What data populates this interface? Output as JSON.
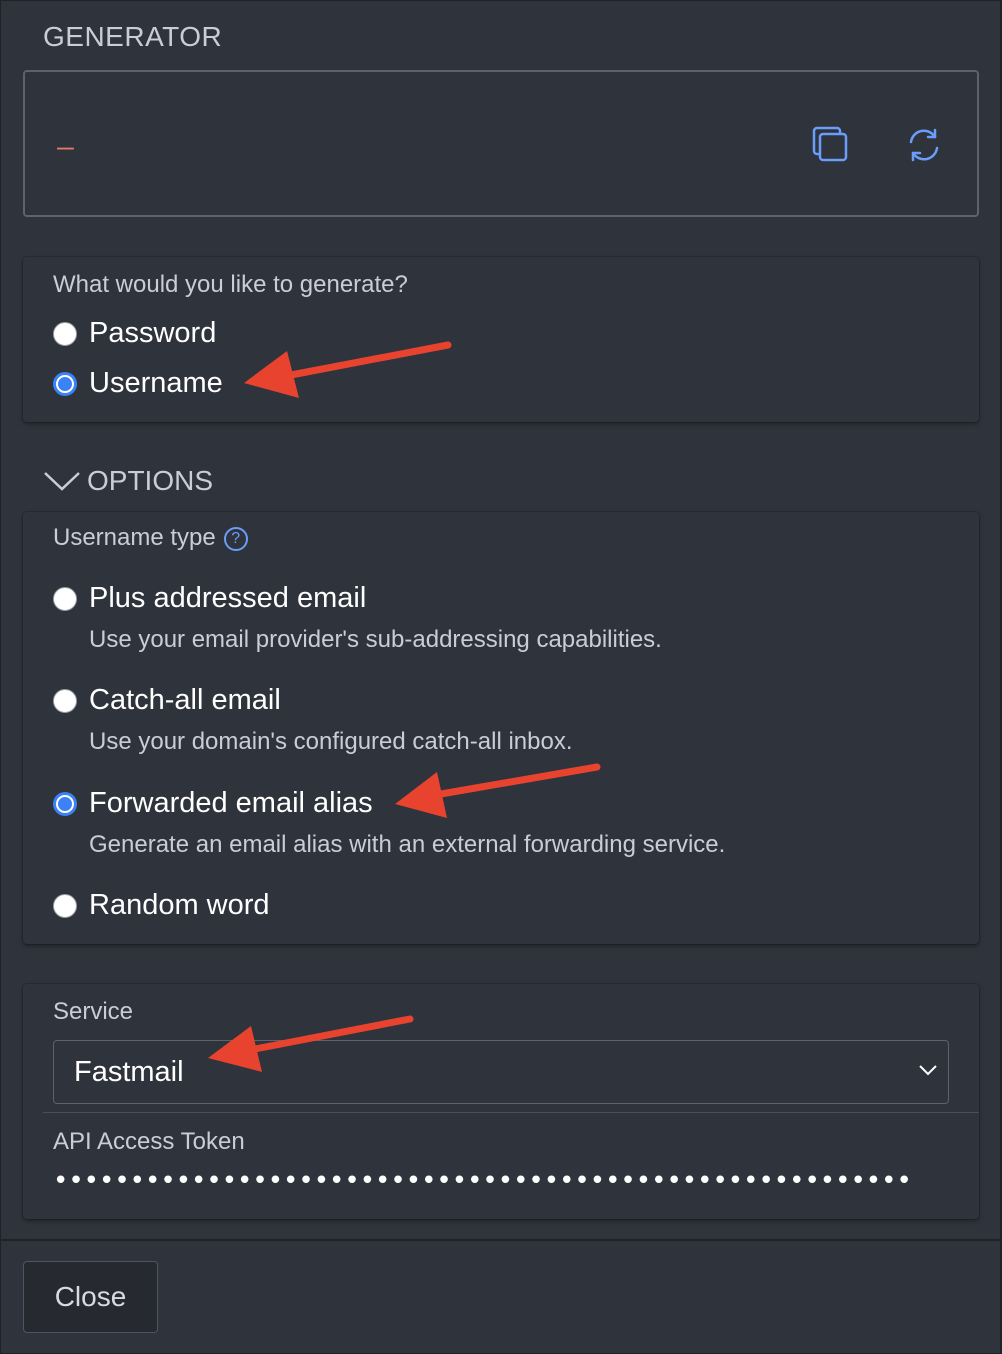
{
  "header": {
    "title": "GENERATOR"
  },
  "generator": {
    "value": "–",
    "copy_icon": "copy-icon",
    "regenerate_icon": "refresh-icon"
  },
  "type_section": {
    "question": "What would you like to generate?",
    "options": [
      {
        "label": "Password",
        "checked": false
      },
      {
        "label": "Username",
        "checked": true
      }
    ]
  },
  "options_section": {
    "header": "OPTIONS",
    "username_type_label": "Username type",
    "help_icon": "?",
    "types": [
      {
        "label": "Plus addressed email",
        "hint": "Use your email provider's sub-addressing capabilities.",
        "checked": false
      },
      {
        "label": "Catch-all email",
        "hint": "Use your domain's configured catch-all inbox.",
        "checked": false
      },
      {
        "label": "Forwarded email alias",
        "hint": "Generate an email alias with an external forwarding service.",
        "checked": true
      },
      {
        "label": "Random word",
        "hint": "",
        "checked": false
      }
    ]
  },
  "service_section": {
    "service_label": "Service",
    "service_value": "Fastmail",
    "token_label": "API Access Token",
    "token_value": "••••••••••••••••••••••••••••••••••••••••••••••••••••••••••••••••••••••••••••••••••••••••••"
  },
  "footer": {
    "close_label": "Close"
  },
  "colors": {
    "background": "#2f333b",
    "accent": "#3b82f6",
    "annotation_arrow": "#e8432f",
    "generated_value": "#e07a6a"
  }
}
